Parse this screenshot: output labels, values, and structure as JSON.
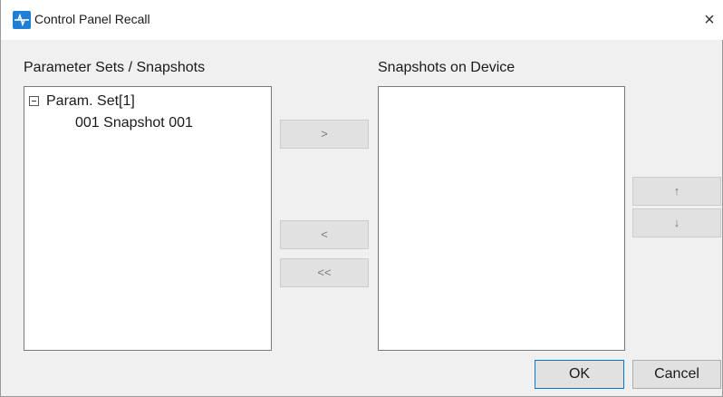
{
  "window": {
    "title": "Control Panel Recall",
    "close_glyph": "×"
  },
  "left_panel": {
    "label": "Parameter Sets / Snapshots",
    "tree": {
      "parent": "Param. Set[1]",
      "children": [
        "001 Snapshot 001"
      ]
    }
  },
  "right_panel": {
    "label": "Snapshots on Device",
    "items": []
  },
  "transfer_buttons": {
    "add": ">",
    "remove": "<",
    "remove_all": "<<"
  },
  "order_buttons": {
    "up": "↑",
    "down": "↓"
  },
  "footer": {
    "ok": "OK",
    "cancel": "Cancel"
  }
}
